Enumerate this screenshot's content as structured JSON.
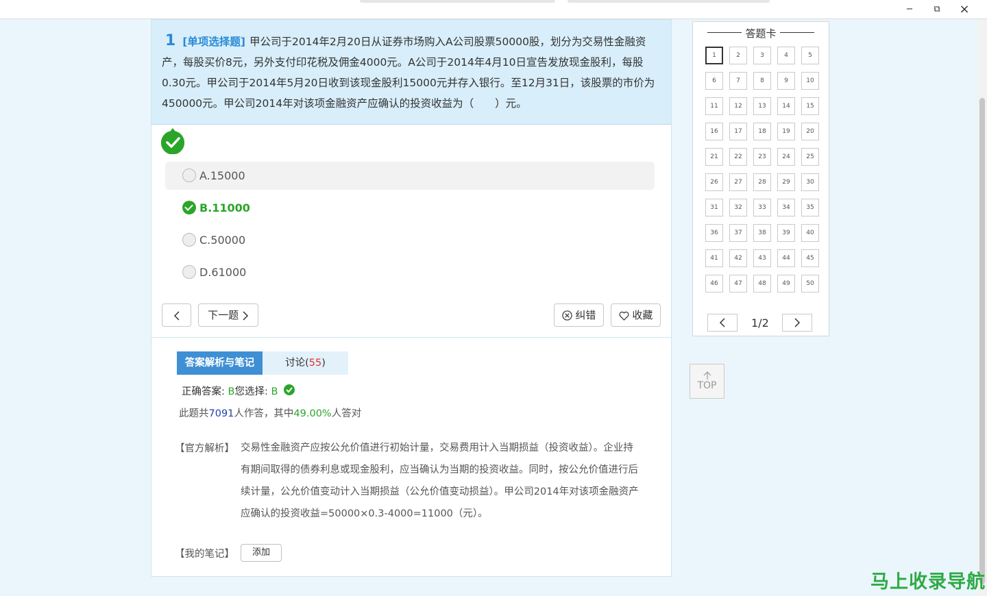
{
  "window": {
    "minimize": "−",
    "restore": "⧉",
    "close": "×"
  },
  "question": {
    "number": "1",
    "type": "[单项选择题]",
    "text": "甲公司于2014年2月20日从证券市场购入A公司股票50000股，划分为交易性金融资产，每股买价8元，另外支付印花税及佣金4000元。A公司于2014年4月10日宣告发放现金股利，每股0.30元。甲公司于2014年5月20日收到该现金股利15000元并存入银行。至12月31日，该股票的市价为450000元。甲公司2014年对该项金融资产应确认的投资收益为（　　）元。",
    "options": [
      {
        "label": "A.15000",
        "state": "unselected"
      },
      {
        "label": "B.11000",
        "state": "correct"
      },
      {
        "label": "C.50000",
        "state": "unselected"
      },
      {
        "label": "D.61000",
        "state": "unselected"
      }
    ]
  },
  "controls": {
    "prev": "‹",
    "next_label": "下一题",
    "report_label": "纠错",
    "favorite_label": "收藏"
  },
  "analysis": {
    "tab_active": "答案解析与笔记",
    "tab_discuss": "讨论(",
    "discuss_count": "55",
    "tab_discuss_end": ")",
    "correct_prefix": "正确答案:",
    "correct_answer": "B",
    "your_prefix": "您选择:",
    "your_answer": "B",
    "stats_1": "此题共",
    "stats_count": "7091",
    "stats_2": "人作答，其中",
    "stats_rate": "49.00%",
    "stats_3": "人答对",
    "official_label": "【官方解析】",
    "official_text": "交易性金融资产应按公允价值进行初始计量，交易费用计入当期损益（投资收益）。企业持有期间取得的债券利息或现金股利，应当确认为当期的投资收益。同时，按公允价值进行后续计量，公允价值变动计入当期损益（公允价值变动损益）。甲公司2014年对该项金融资产应确认的投资收益=50000×0.3-4000=11000（元）。",
    "notes_label": "【我的笔记】",
    "add_label": "添加"
  },
  "answer_sheet": {
    "title": "答题卡",
    "numbers": [
      "1",
      "2",
      "3",
      "4",
      "5",
      "6",
      "7",
      "8",
      "9",
      "10",
      "11",
      "12",
      "13",
      "14",
      "15",
      "16",
      "17",
      "18",
      "19",
      "20",
      "21",
      "22",
      "23",
      "24",
      "25",
      "26",
      "27",
      "28",
      "29",
      "30",
      "31",
      "32",
      "33",
      "34",
      "35",
      "36",
      "37",
      "38",
      "39",
      "40",
      "41",
      "42",
      "43",
      "44",
      "45",
      "46",
      "47",
      "48",
      "49",
      "50"
    ],
    "current": "1",
    "page_text": "1/2",
    "prev": "‹",
    "next": "›"
  },
  "top_button": "TOP",
  "watermark": "马上收录导航",
  "colors": {
    "accent_blue": "#3e8fd4",
    "correct_green": "#2aa52a",
    "question_bg": "#d8eefa"
  }
}
